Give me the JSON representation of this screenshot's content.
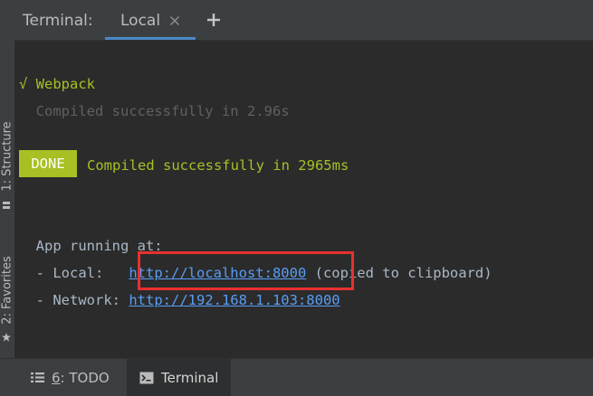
{
  "header": {
    "panel_label": "Terminal:",
    "tab_label": "Local"
  },
  "sidebar": {
    "structure_label": "1: Structure",
    "favorites_label": "2: Favorites"
  },
  "terminal": {
    "webpack_check": "√ Webpack",
    "compiled_msg": "  Compiled successfully in 2.96s",
    "done_badge": "DONE",
    "done_msg": "Compiled successfully in 2965ms",
    "app_running": "  App running at:",
    "local_prefix": "  - Local:   ",
    "local_url": "http://localhost:8000",
    "local_suffix": " (copied to clipboard)",
    "network_prefix": "  - Network: ",
    "network_url": "http://192.168.1.103:8000"
  },
  "bottom_bar": {
    "todo_num": "6",
    "todo_label": ": TODO",
    "terminal_label": "Terminal"
  },
  "colors": {
    "accent_green": "#a8c023",
    "link_blue": "#589df6",
    "highlight_red": "#e8312f",
    "tab_underline": "#4a88c7"
  }
}
